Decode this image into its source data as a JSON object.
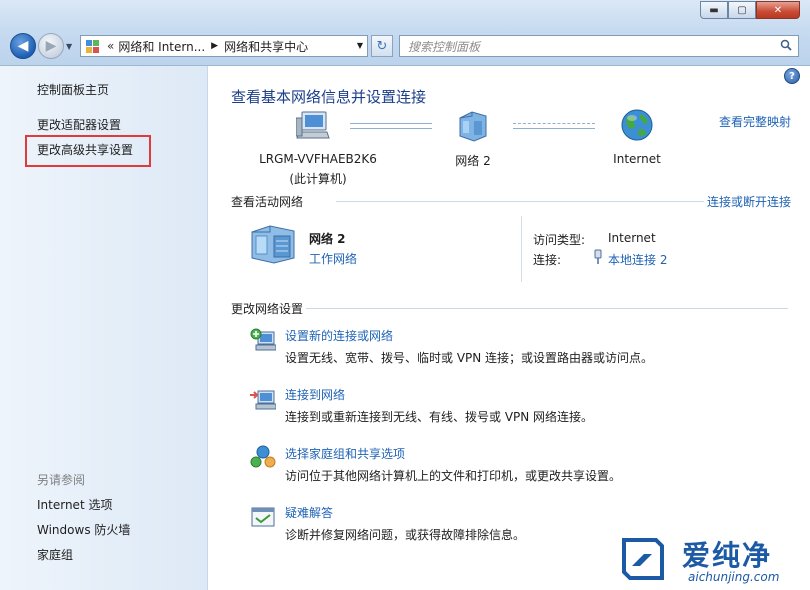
{
  "window": {
    "minimize_glyph": "▬",
    "maximize_glyph": "▢",
    "close_glyph": "✕"
  },
  "toolbar": {
    "back_glyph": "◀",
    "forward_glyph": "▶",
    "history_glyph": "▼",
    "address_prefix": "«",
    "breadcrumbs": [
      "网络和 Intern...",
      "网络和共享中心"
    ],
    "breadcrumb_separator": "▶",
    "address_dropdown_glyph": "▼",
    "refresh_glyph": "↻",
    "search_placeholder": "搜索控制面板"
  },
  "sidebar": {
    "items": [
      {
        "label": "控制面板主页"
      },
      {
        "label": "更改适配器设置"
      },
      {
        "label": "更改高级共享设置",
        "highlighted": true
      }
    ],
    "see_also_heading": "另请参阅",
    "see_also": [
      {
        "label": "Internet 选项"
      },
      {
        "label": "Windows 防火墙"
      },
      {
        "label": "家庭组"
      }
    ]
  },
  "main": {
    "help_glyph": "?",
    "title": "查看基本网络信息并设置连接",
    "full_map_link": "查看完整映射",
    "map": {
      "computer": {
        "name": "LRGM-VVFHAEB2K6",
        "note": "(此计算机)",
        "icon": "computer-icon"
      },
      "network": {
        "name": "网络  2",
        "icon": "network-icon"
      },
      "internet": {
        "name": "Internet",
        "icon": "globe-icon"
      }
    },
    "active_networks": {
      "heading": "查看活动网络",
      "connect_link": "连接或断开连接",
      "network_name": "网络  2",
      "network_type": "工作网络",
      "access_type_label": "访问类型:",
      "access_type_value": "Internet",
      "connections_label": "连接:",
      "connection_value": "本地连接 2"
    },
    "change_settings": {
      "heading": "更改网络设置",
      "tasks": [
        {
          "title": "设置新的连接或网络",
          "desc": "设置无线、宽带、拨号、临时或 VPN 连接；或设置路由器或访问点。",
          "icon": "new-connection-icon"
        },
        {
          "title": "连接到网络",
          "desc": "连接到或重新连接到无线、有线、拨号或 VPN 网络连接。",
          "icon": "connect-network-icon"
        },
        {
          "title": "选择家庭组和共享选项",
          "desc": "访问位于其他网络计算机上的文件和打印机，或更改共享设置。",
          "icon": "homegroup-icon"
        },
        {
          "title": "疑难解答",
          "desc": "诊断并修复网络问题，或获得故障排除信息。",
          "icon": "troubleshoot-icon"
        }
      ]
    }
  },
  "watermark": {
    "brand_cn": "爱纯净",
    "brand_url": "aichunjing.com"
  },
  "colors": {
    "link": "#1f63b5",
    "title": "#1b3f8a",
    "highlight_box": "#e03a3a",
    "sidebar_bg": "#dde9f6"
  }
}
